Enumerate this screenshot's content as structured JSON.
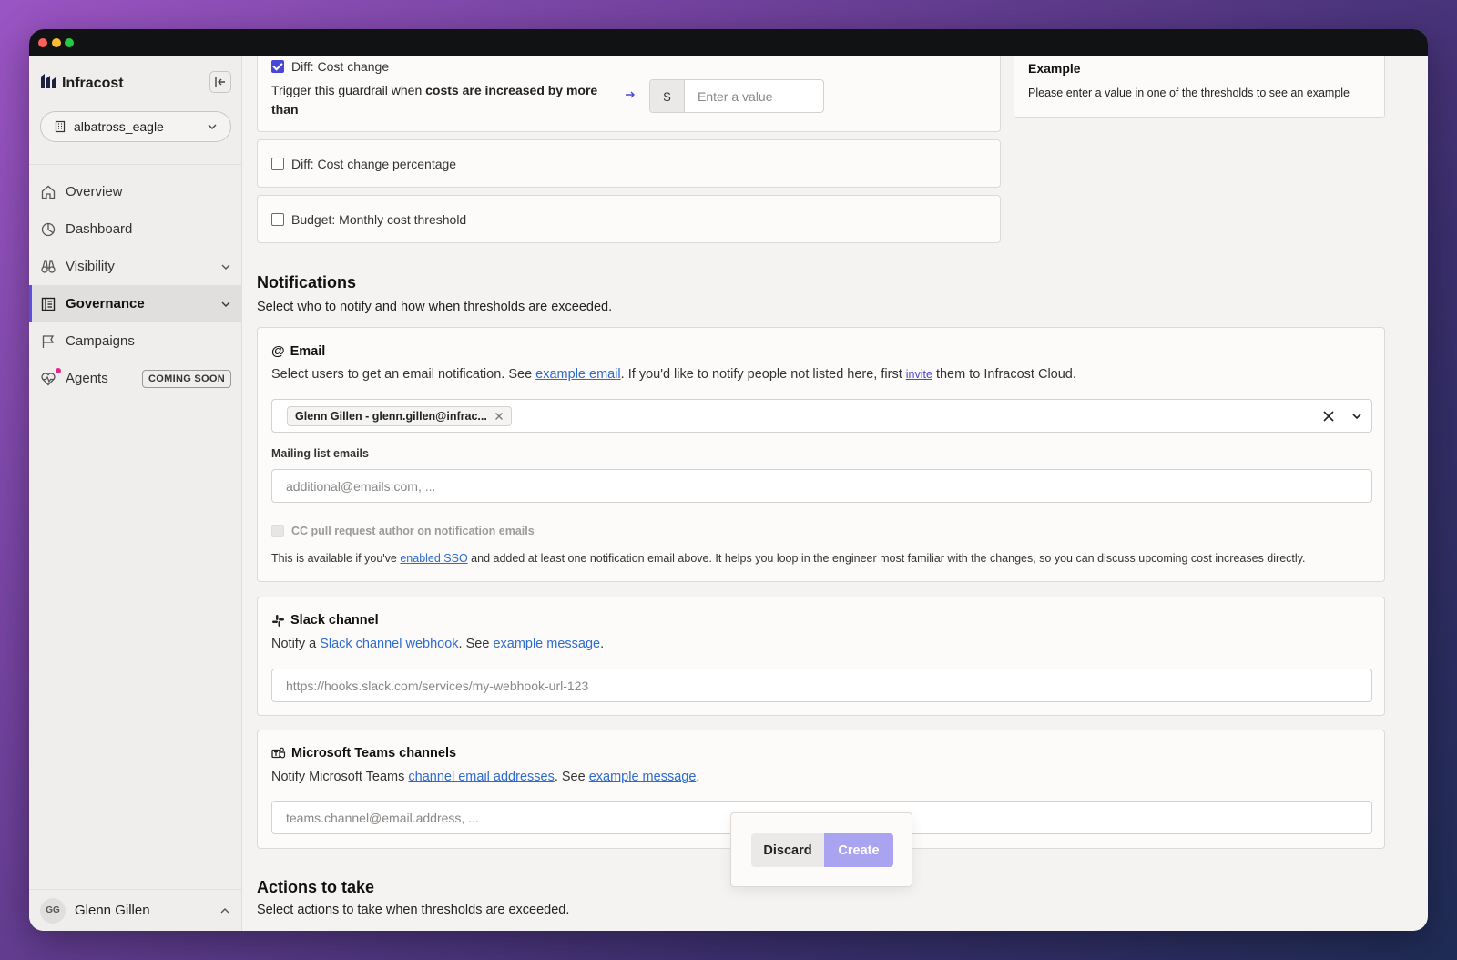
{
  "sidebar": {
    "brand": "Infracost",
    "org": "albatross_eagle",
    "items": [
      {
        "label": "Overview"
      },
      {
        "label": "Dashboard"
      },
      {
        "label": "Visibility"
      },
      {
        "label": "Governance"
      },
      {
        "label": "Campaigns"
      },
      {
        "label": "Agents",
        "badge": "COMING SOON"
      }
    ],
    "user": {
      "initials": "GG",
      "name": "Glenn Gillen"
    }
  },
  "thresholds": {
    "cost_change": {
      "label": "Diff: Cost change",
      "checked": true,
      "trigger_prefix": "Trigger this guardrail when ",
      "trigger_bold": "costs are increased by more than",
      "currency": "$",
      "placeholder": "Enter a value"
    },
    "cost_change_pct": {
      "label": "Diff: Cost change percentage"
    },
    "budget": {
      "label": "Budget: Monthly cost threshold"
    }
  },
  "example": {
    "title": "Example",
    "text": "Please enter a value in one of the thresholds to see an example"
  },
  "notifications": {
    "title": "Notifications",
    "subtitle": "Select who to notify and how when thresholds are exceeded.",
    "email": {
      "title": "Email",
      "desc_1": "Select users to get an email notification. See ",
      "link_1": "example email",
      "desc_2": ". If you'd like to notify people not listed here, first ",
      "link_2": "invite",
      "desc_3": " them to Infracost Cloud.",
      "selected_user": "Glenn Gillen - glenn.gillen@infrac...",
      "mailing_label": "Mailing list emails",
      "mailing_placeholder": "additional@emails.com, ...",
      "cc_label": "CC pull request author on notification emails",
      "sso_1": "This is available if you've ",
      "sso_link": "enabled SSO",
      "sso_2": " and added at least one notification email above. It helps you loop in the engineer most familiar with the changes, so you can discuss upcoming cost increases directly."
    },
    "slack": {
      "title": "Slack channel",
      "desc_1": "Notify a ",
      "link_1": "Slack channel webhook",
      "desc_2": ". See ",
      "link_2": "example message",
      "desc_3": ".",
      "placeholder": "https://hooks.slack.com/services/my-webhook-url-123"
    },
    "teams": {
      "title": "Microsoft Teams channels",
      "desc_1": "Notify Microsoft Teams ",
      "link_1": "channel email addresses",
      "desc_2": ". See ",
      "link_2": "example message",
      "desc_3": ".",
      "placeholder": "teams.channel@email.address, ..."
    }
  },
  "actions": {
    "title": "Actions to take",
    "subtitle": "Select actions to take when thresholds are exceeded."
  },
  "footer_bar": {
    "discard": "Discard",
    "create": "Create"
  },
  "colors": {
    "accent": "#4b47d6",
    "create_button": "#a9a3f0",
    "link": "#2d6bcf",
    "notification_dot": "#e6288a"
  }
}
